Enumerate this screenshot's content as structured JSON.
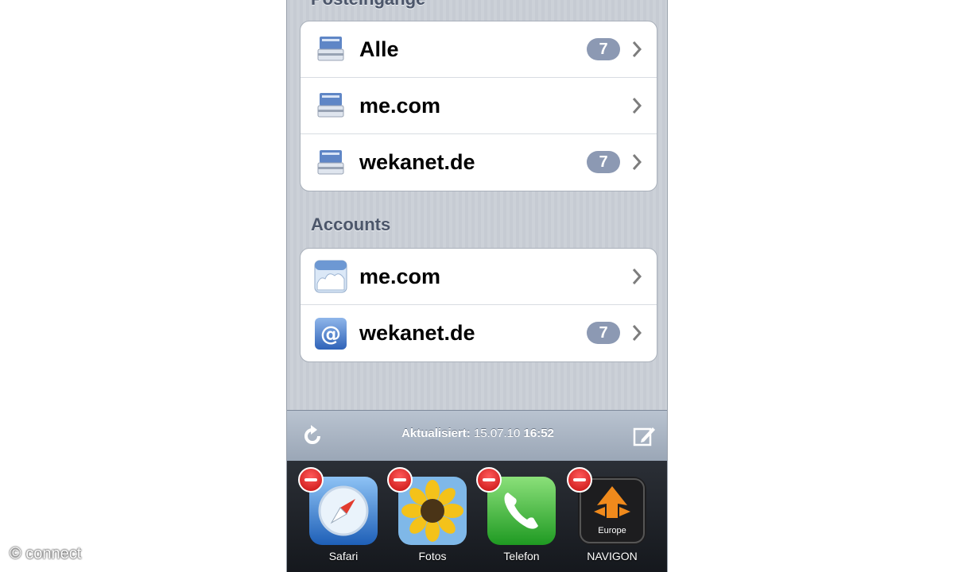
{
  "sections": {
    "inboxes_title": "Posteingänge",
    "accounts_title": "Accounts"
  },
  "inboxes": [
    {
      "label": "Alle",
      "badge": "7",
      "icon": "inbox-tray-icon"
    },
    {
      "label": "me.com",
      "badge": "",
      "icon": "inbox-tray-icon"
    },
    {
      "label": "wekanet.de",
      "badge": "7",
      "icon": "inbox-tray-icon"
    }
  ],
  "accounts": [
    {
      "label": "me.com",
      "badge": "",
      "icon": "mobileme-cloud-icon"
    },
    {
      "label": "wekanet.de",
      "badge": "7",
      "icon": "at-sign-icon"
    }
  ],
  "toolbar": {
    "status_prefix": "Aktualisiert:",
    "status_date": "15.07.10",
    "status_time": "16:52"
  },
  "dock": {
    "apps": [
      {
        "label": "Safari",
        "icon": "safari-compass-icon"
      },
      {
        "label": "Fotos",
        "icon": "photos-sunflower-icon"
      },
      {
        "label": "Telefon",
        "icon": "phone-handset-icon"
      },
      {
        "label": "NAVIGON",
        "icon": "navigon-arrow-icon",
        "sublabel": "Europe"
      }
    ]
  },
  "watermark": "© connect",
  "colors": {
    "badge": "#8c99b3",
    "delete_badge": "#d41a1a",
    "toolbar": "#a9b4c3"
  }
}
